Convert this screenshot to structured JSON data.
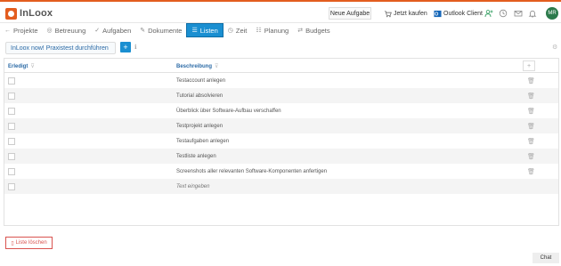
{
  "app": {
    "logo_text": "InLoox"
  },
  "header": {
    "new_task": "Neue Aufgabe",
    "buy_now": "Jetzt kaufen",
    "outlook_client": "Outlook Client",
    "avatar_initials": "MR"
  },
  "nav": {
    "items": [
      {
        "label": "Projekte",
        "icon": "arrow-left-icon"
      },
      {
        "label": "Betreuung",
        "icon": "support-icon"
      },
      {
        "label": "Aufgaben",
        "icon": "check-icon"
      },
      {
        "label": "Dokumente",
        "icon": "pencil-icon"
      },
      {
        "label": "Listen",
        "icon": "list-icon",
        "active": true
      },
      {
        "label": "Zeit",
        "icon": "clock-icon"
      },
      {
        "label": "Planung",
        "icon": "planning-icon"
      },
      {
        "label": "Budgets",
        "icon": "exchange-icon"
      }
    ]
  },
  "list": {
    "title": "InLoox now! Praxistest durchführen",
    "add_label": "+"
  },
  "table": {
    "headers": {
      "done": "Erledigt",
      "description": "Beschreibung",
      "add": "+"
    },
    "rows": [
      {
        "description": "Testaccount anlegen"
      },
      {
        "description": "Tutorial absolvieren"
      },
      {
        "description": "Überblick über Software-Aufbau verschaffen"
      },
      {
        "description": "Testprojekt anlegen"
      },
      {
        "description": "Testaufgaben anlegen"
      },
      {
        "description": "Testliste anlegen"
      },
      {
        "description": "Screenshots aller relevanten Software-Komponenten anfertigen"
      }
    ],
    "placeholder": "Text eingeben"
  },
  "footer": {
    "delete_list": "Liste löschen",
    "chat": "Chat"
  },
  "colors": {
    "accent": "#1a8fd1",
    "brand": "#e35d1f",
    "danger": "#d9534f"
  }
}
